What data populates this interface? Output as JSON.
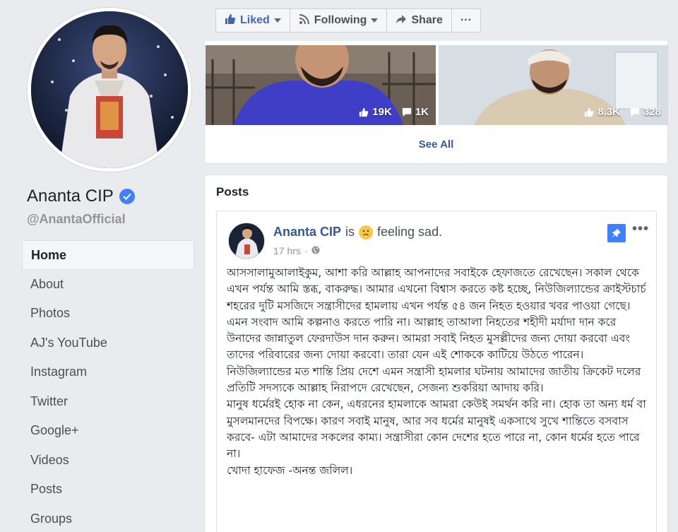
{
  "page": {
    "name": "Ananta CIP",
    "handle": "@AnantaOfficial"
  },
  "nav": {
    "items": [
      {
        "label": "Home",
        "active": true
      },
      {
        "label": "About"
      },
      {
        "label": "Photos"
      },
      {
        "label": "AJ's YouTube"
      },
      {
        "label": "Instagram"
      },
      {
        "label": "Twitter"
      },
      {
        "label": "Google+"
      },
      {
        "label": "Videos"
      },
      {
        "label": "Posts"
      },
      {
        "label": "Groups"
      }
    ]
  },
  "actions": {
    "liked": "Liked",
    "following": "Following",
    "share": "Share",
    "more": "···"
  },
  "videos": {
    "items": [
      {
        "likes": "19K",
        "comments": "1K"
      },
      {
        "likes": "8.3K",
        "comments": "328"
      }
    ],
    "see_all": "See All"
  },
  "posts": {
    "title": "Posts",
    "post": {
      "author": "Ananta CIP",
      "is_text": "is",
      "feeling": "feeling sad.",
      "time": "17 hrs",
      "paragraphs": [
        "আসসালামুআলাইকুম, আশা করি আল্লাহ আপনাদের সবাইকে হেফাজতে রেখেছেন। সকাল থেকে এখন পর্যন্ত আমি স্তব্ধ, বাকরুদ্ধ। আমার এখনো বিশ্বাস করতে কষ্ট হচ্ছে, নিউজিল্যান্ডের ক্রাইস্টচার্চ শহরের দুটি মসজিদে সন্ত্রাসীদের হামলায় এখন পর্যন্ত ৫৪ জন নিহত হওয়ার খবর পাওয়া গেছে। এমন সংবাদ আমি কল্পনাও করতে পারি না। আল্লাহ তাআলা নিহতের শহীদী মর্যাদা দান করে উনাদের জান্নাতুল ফেরদাউস দান করুন। আমরা সবাই নিহত মুসল্লীদের জন্য দোয়া করবো এবং তাদের পরিবারের জন্য দোয়া করবো। তারা যেন এই শোককে কাটিয়ে উঠতে পারেন। নিউজিল্যান্ডের মত শান্তি প্রিয় দেশে এমন সন্ত্রাসী হামলার ঘটনায় আমাদের জাতীয় ক্রিকেট দলের প্রতিটি সদস্যকে আল্লাহ নিরাপদে রেখেছেন, সেজন্য শুকরিয়া আদায় করি।",
        "মানুষ ধর্মেরই হোক না কেন, এধরনের হামলাকে আমরা কেউই সমর্থন করি না। হোক তা অন্য ধর্ম বা মুসলমানদের বিপক্ষে। কারণ সবাই মানুষ, আর সব ধর্মের মানুষই একসাথে সুখে শান্তিতে বসবাস করবে- এটা আমাদের সকলের কাম্য। সন্ত্রাসীরা কোন দেশের হতে পারে না, কোন ধর্মের হতে পারে না।",
        "খোদা হাফেজ -অনন্ত জলিল।"
      ]
    }
  },
  "colors": {
    "link": "#365899",
    "accent": "#4080ff",
    "muted": "#90949c"
  },
  "icons": {
    "verified": "verified-badge-icon",
    "like": "thumbs-up-icon",
    "rss": "rss-icon",
    "share": "share-arrow-icon",
    "comment": "comment-icon",
    "globe": "globe-icon",
    "pin": "pin-icon",
    "emoji": "sad-face-emoji-icon"
  }
}
